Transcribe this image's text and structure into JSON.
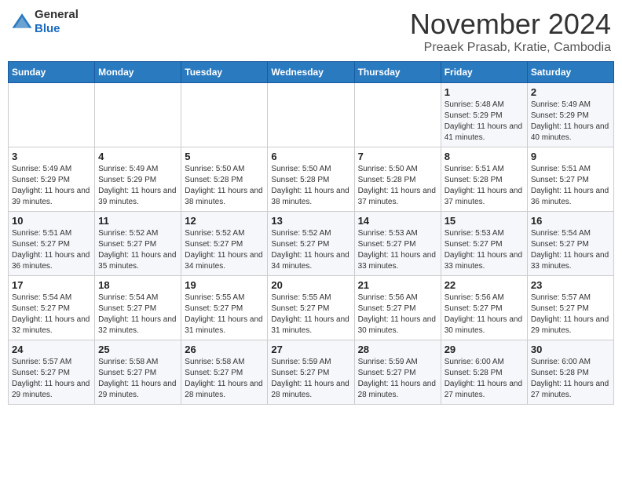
{
  "header": {
    "logo_line1": "General",
    "logo_line2": "Blue",
    "month": "November 2024",
    "location": "Preaek Prasab, Kratie, Cambodia"
  },
  "weekdays": [
    "Sunday",
    "Monday",
    "Tuesday",
    "Wednesday",
    "Thursday",
    "Friday",
    "Saturday"
  ],
  "weeks": [
    [
      {
        "day": "",
        "sunrise": "",
        "sunset": "",
        "daylight": ""
      },
      {
        "day": "",
        "sunrise": "",
        "sunset": "",
        "daylight": ""
      },
      {
        "day": "",
        "sunrise": "",
        "sunset": "",
        "daylight": ""
      },
      {
        "day": "",
        "sunrise": "",
        "sunset": "",
        "daylight": ""
      },
      {
        "day": "",
        "sunrise": "",
        "sunset": "",
        "daylight": ""
      },
      {
        "day": "1",
        "sunrise": "Sunrise: 5:48 AM",
        "sunset": "Sunset: 5:29 PM",
        "daylight": "Daylight: 11 hours and 41 minutes."
      },
      {
        "day": "2",
        "sunrise": "Sunrise: 5:49 AM",
        "sunset": "Sunset: 5:29 PM",
        "daylight": "Daylight: 11 hours and 40 minutes."
      }
    ],
    [
      {
        "day": "3",
        "sunrise": "Sunrise: 5:49 AM",
        "sunset": "Sunset: 5:29 PM",
        "daylight": "Daylight: 11 hours and 39 minutes."
      },
      {
        "day": "4",
        "sunrise": "Sunrise: 5:49 AM",
        "sunset": "Sunset: 5:29 PM",
        "daylight": "Daylight: 11 hours and 39 minutes."
      },
      {
        "day": "5",
        "sunrise": "Sunrise: 5:50 AM",
        "sunset": "Sunset: 5:28 PM",
        "daylight": "Daylight: 11 hours and 38 minutes."
      },
      {
        "day": "6",
        "sunrise": "Sunrise: 5:50 AM",
        "sunset": "Sunset: 5:28 PM",
        "daylight": "Daylight: 11 hours and 38 minutes."
      },
      {
        "day": "7",
        "sunrise": "Sunrise: 5:50 AM",
        "sunset": "Sunset: 5:28 PM",
        "daylight": "Daylight: 11 hours and 37 minutes."
      },
      {
        "day": "8",
        "sunrise": "Sunrise: 5:51 AM",
        "sunset": "Sunset: 5:28 PM",
        "daylight": "Daylight: 11 hours and 37 minutes."
      },
      {
        "day": "9",
        "sunrise": "Sunrise: 5:51 AM",
        "sunset": "Sunset: 5:27 PM",
        "daylight": "Daylight: 11 hours and 36 minutes."
      }
    ],
    [
      {
        "day": "10",
        "sunrise": "Sunrise: 5:51 AM",
        "sunset": "Sunset: 5:27 PM",
        "daylight": "Daylight: 11 hours and 36 minutes."
      },
      {
        "day": "11",
        "sunrise": "Sunrise: 5:52 AM",
        "sunset": "Sunset: 5:27 PM",
        "daylight": "Daylight: 11 hours and 35 minutes."
      },
      {
        "day": "12",
        "sunrise": "Sunrise: 5:52 AM",
        "sunset": "Sunset: 5:27 PM",
        "daylight": "Daylight: 11 hours and 34 minutes."
      },
      {
        "day": "13",
        "sunrise": "Sunrise: 5:52 AM",
        "sunset": "Sunset: 5:27 PM",
        "daylight": "Daylight: 11 hours and 34 minutes."
      },
      {
        "day": "14",
        "sunrise": "Sunrise: 5:53 AM",
        "sunset": "Sunset: 5:27 PM",
        "daylight": "Daylight: 11 hours and 33 minutes."
      },
      {
        "day": "15",
        "sunrise": "Sunrise: 5:53 AM",
        "sunset": "Sunset: 5:27 PM",
        "daylight": "Daylight: 11 hours and 33 minutes."
      },
      {
        "day": "16",
        "sunrise": "Sunrise: 5:54 AM",
        "sunset": "Sunset: 5:27 PM",
        "daylight": "Daylight: 11 hours and 33 minutes."
      }
    ],
    [
      {
        "day": "17",
        "sunrise": "Sunrise: 5:54 AM",
        "sunset": "Sunset: 5:27 PM",
        "daylight": "Daylight: 11 hours and 32 minutes."
      },
      {
        "day": "18",
        "sunrise": "Sunrise: 5:54 AM",
        "sunset": "Sunset: 5:27 PM",
        "daylight": "Daylight: 11 hours and 32 minutes."
      },
      {
        "day": "19",
        "sunrise": "Sunrise: 5:55 AM",
        "sunset": "Sunset: 5:27 PM",
        "daylight": "Daylight: 11 hours and 31 minutes."
      },
      {
        "day": "20",
        "sunrise": "Sunrise: 5:55 AM",
        "sunset": "Sunset: 5:27 PM",
        "daylight": "Daylight: 11 hours and 31 minutes."
      },
      {
        "day": "21",
        "sunrise": "Sunrise: 5:56 AM",
        "sunset": "Sunset: 5:27 PM",
        "daylight": "Daylight: 11 hours and 30 minutes."
      },
      {
        "day": "22",
        "sunrise": "Sunrise: 5:56 AM",
        "sunset": "Sunset: 5:27 PM",
        "daylight": "Daylight: 11 hours and 30 minutes."
      },
      {
        "day": "23",
        "sunrise": "Sunrise: 5:57 AM",
        "sunset": "Sunset: 5:27 PM",
        "daylight": "Daylight: 11 hours and 29 minutes."
      }
    ],
    [
      {
        "day": "24",
        "sunrise": "Sunrise: 5:57 AM",
        "sunset": "Sunset: 5:27 PM",
        "daylight": "Daylight: 11 hours and 29 minutes."
      },
      {
        "day": "25",
        "sunrise": "Sunrise: 5:58 AM",
        "sunset": "Sunset: 5:27 PM",
        "daylight": "Daylight: 11 hours and 29 minutes."
      },
      {
        "day": "26",
        "sunrise": "Sunrise: 5:58 AM",
        "sunset": "Sunset: 5:27 PM",
        "daylight": "Daylight: 11 hours and 28 minutes."
      },
      {
        "day": "27",
        "sunrise": "Sunrise: 5:59 AM",
        "sunset": "Sunset: 5:27 PM",
        "daylight": "Daylight: 11 hours and 28 minutes."
      },
      {
        "day": "28",
        "sunrise": "Sunrise: 5:59 AM",
        "sunset": "Sunset: 5:27 PM",
        "daylight": "Daylight: 11 hours and 28 minutes."
      },
      {
        "day": "29",
        "sunrise": "Sunrise: 6:00 AM",
        "sunset": "Sunset: 5:28 PM",
        "daylight": "Daylight: 11 hours and 27 minutes."
      },
      {
        "day": "30",
        "sunrise": "Sunrise: 6:00 AM",
        "sunset": "Sunset: 5:28 PM",
        "daylight": "Daylight: 11 hours and 27 minutes."
      }
    ]
  ]
}
